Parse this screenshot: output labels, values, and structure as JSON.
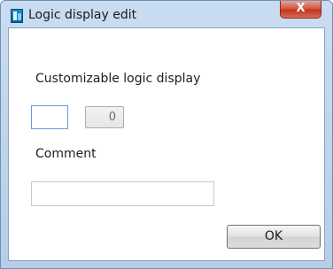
{
  "window": {
    "title": "Logic display edit",
    "close_glyph": "X",
    "icon": "app-icon"
  },
  "form": {
    "logic_label": "Customizable logic display",
    "logic_value": "",
    "logic_count": "0",
    "comment_label": "Comment",
    "comment_value": ""
  },
  "buttons": {
    "ok_label": "OK"
  },
  "colors": {
    "frame": "#b7cde8",
    "close_button": "#c0321d",
    "focus_border": "#5d9ee0"
  }
}
